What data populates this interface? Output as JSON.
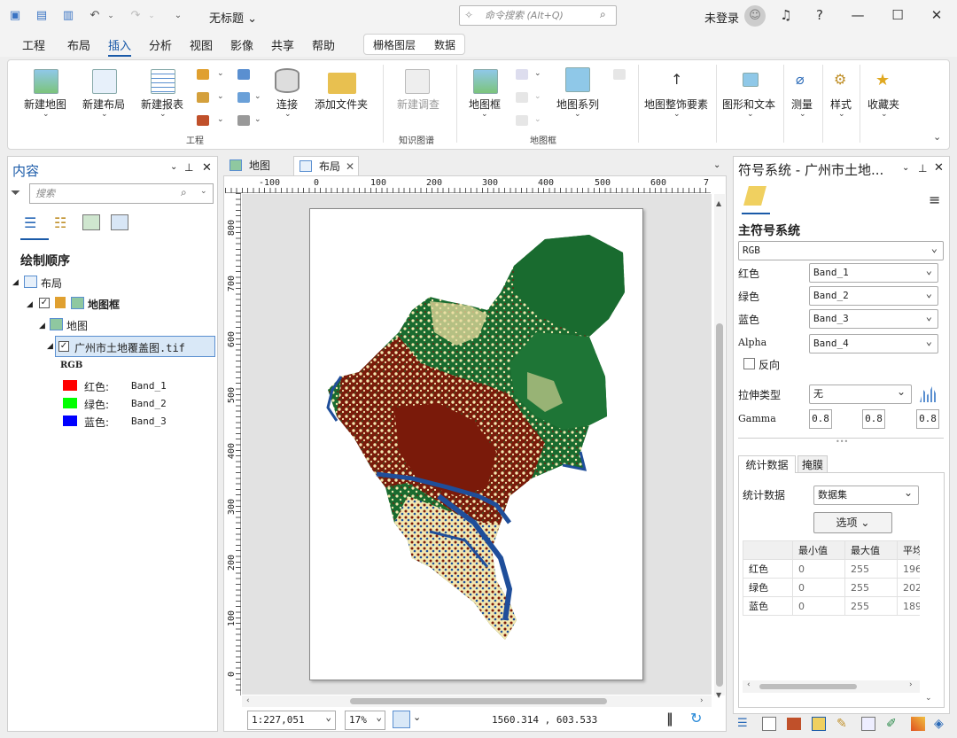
{
  "app": {
    "title": "无标题",
    "command_search_placeholder": "命令搜索 (Alt+Q)",
    "user": "未登录"
  },
  "menu": [
    "工程",
    "布局",
    "插入",
    "分析",
    "视图",
    "影像",
    "共享",
    "帮助"
  ],
  "context_tabs": [
    "栅格图层",
    "数据"
  ],
  "ribbon": {
    "new_map": "新建地图",
    "new_layout": "新建布局",
    "new_report": "新建报表",
    "connect": "连接",
    "add_folder": "添加文件夹",
    "group_project": "工程",
    "new_survey": "新建调查",
    "group_knowledge": "知识图谱",
    "map_frame": "地图框",
    "map_series": "地图系列",
    "group_mapframe": "地图框",
    "map_surround": "地图整饰要素",
    "graphics_text": "图形和文本",
    "measure": "测量",
    "style": "样式",
    "favorites": "收藏夹"
  },
  "contents": {
    "title": "内容",
    "search_placeholder": "搜索",
    "draw_order": "绘制顺序",
    "layout": "布局",
    "map_frame": "地图框",
    "map": "地图",
    "layer": "广州市土地覆盖图.tif",
    "rgb": "RGB",
    "bands": [
      {
        "label": "红色:",
        "band": "Band_1",
        "color": "#ff0000"
      },
      {
        "label": "绿色:",
        "band": "Band_2",
        "color": "#00ff00"
      },
      {
        "label": "蓝色:",
        "band": "Band_3",
        "color": "#0000ff"
      }
    ]
  },
  "view_tabs": [
    "地图",
    "布局"
  ],
  "ruler": {
    "h": [
      "-100",
      "0",
      "100",
      "200",
      "300",
      "400",
      "500",
      "600",
      "7"
    ],
    "v": [
      "800",
      "700",
      "600",
      "500",
      "400",
      "300",
      "200",
      "100",
      "0"
    ]
  },
  "status": {
    "scale": "1:227,051",
    "zoom": "17%",
    "coords": "1560.314 , 603.533"
  },
  "symbology": {
    "title": "符号系统 - 广州市土地...",
    "primary": "主符号系统",
    "method": "RGB",
    "red_label": "红色",
    "red": "Band_1",
    "green_label": "绿色",
    "green": "Band_2",
    "blue_label": "蓝色",
    "blue": "Band_3",
    "alpha_label": "Alpha",
    "alpha": "Band_4",
    "invert": "反向",
    "stretch_label": "拉伸类型",
    "stretch": "无",
    "gamma_label": "Gamma",
    "gamma": [
      "0.8",
      "0.8",
      "0.8"
    ],
    "tabs": [
      "统计数据",
      "掩膜"
    ],
    "stats_label": "统计数据",
    "stats_value": "数据集",
    "options": "选项",
    "table": {
      "headers": [
        "最小值",
        "最大值",
        "平均"
      ],
      "rows": [
        {
          "name": "红色",
          "min": "0",
          "max": "255",
          "mean": "196"
        },
        {
          "name": "绿色",
          "min": "0",
          "max": "255",
          "mean": "202"
        },
        {
          "name": "蓝色",
          "min": "0",
          "max": "255",
          "mean": "189"
        }
      ]
    }
  },
  "colors": {
    "accent": "#1a5aa8",
    "land_green": "#196b2f",
    "land_red": "#7a1a0a",
    "land_cream": "#f3e8b0",
    "water_blue": "#1f4e9a"
  }
}
